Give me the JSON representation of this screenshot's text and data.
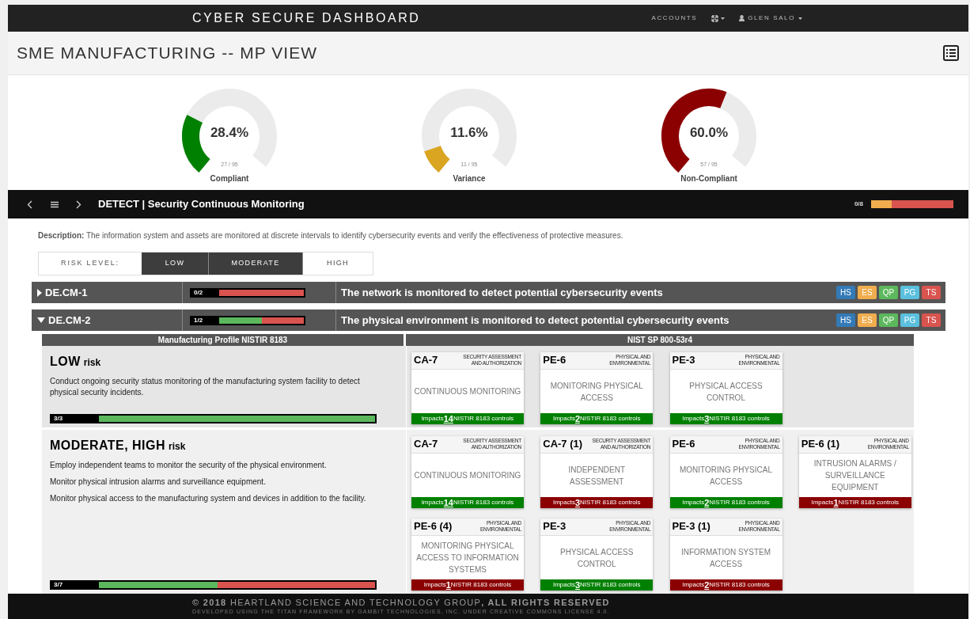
{
  "navbar": {
    "brand": "CYBER SECURE DASHBOARD",
    "links": [
      "ACCOUNTS"
    ],
    "user": "GLEN SALO"
  },
  "page_title": "SME MANUFACTURING -- MP VIEW",
  "gauges": [
    {
      "value": "28.4%",
      "count": "27 / 95",
      "label": "Compliant",
      "color": "#008000"
    },
    {
      "value": "11.6%",
      "count": "11 / 95",
      "label": "Variance",
      "color": "#daa520"
    },
    {
      "value": "60.0%",
      "count": "57 / 95",
      "label": "Non-Compliant",
      "color": "#8b0000"
    }
  ],
  "section": {
    "title": "DETECT | Security Continuous Monitoring",
    "progress_text": "0/8",
    "segments": [
      {
        "color": "#f0ad4e"
      },
      {
        "color": "#d9534f"
      }
    ]
  },
  "description": "**Description:** The information system and assets are monitored at discrete intervals to identify cybersecurity events and verify the effectiveness of protective measures.",
  "risk_level": {
    "label": "RISK LEVEL:",
    "options": [
      {
        "label": "LOW",
        "selected": true
      },
      {
        "label": "MODERATE",
        "selected": true
      },
      {
        "label": "HIGH",
        "selected": false
      }
    ]
  },
  "subcategories": [
    {
      "id": "DE.CM-1",
      "expanded": false,
      "progress_text": "0/2",
      "segments": [
        {
          "color": "#d9534f"
        }
      ],
      "text": "The network is monitored to detect potential cybersecurity events",
      "tags": [
        {
          "label": "HS",
          "color": "#337ab7"
        },
        {
          "label": "ES",
          "color": "#f0ad4e"
        },
        {
          "label": "QP",
          "color": "#5cb85c"
        },
        {
          "label": "PG",
          "color": "#5bc0de"
        },
        {
          "label": "TS",
          "color": "#d9534f"
        }
      ]
    },
    {
      "id": "DE.CM-2",
      "expanded": true,
      "progress_text": "1/2",
      "segments": [
        {
          "color": "#5cb85c"
        },
        {
          "color": "#d9534f"
        }
      ],
      "text": "The physical environment is monitored to detect potential cybersecurity events",
      "tags": [
        {
          "label": "HS",
          "color": "#337ab7"
        },
        {
          "label": "ES",
          "color": "#f0ad4e"
        },
        {
          "label": "QP",
          "color": "#5cb85c"
        },
        {
          "label": "PG",
          "color": "#5bc0de"
        },
        {
          "label": "TS",
          "color": "#d9534f"
        }
      ]
    }
  ],
  "detail": {
    "left_heading": "Manufacturing Profile NISTIR 8183",
    "right_heading": "NIST SP 800-53r4",
    "rows": [
      {
        "risk": "LOW",
        "suffix": "risk",
        "statements": [
          "Conduct ongoing security status monitoring of the manufacturing system facility to detect physical security incidents."
        ],
        "progress_text": "3/3",
        "segments": [
          {
            "color": "#5cb85c"
          }
        ],
        "controls": [
          {
            "id": "CA-7",
            "family": "SECURITY ASSESSMENT AND AUTHORIZATION",
            "title": "CONTINUOUS MONITORING",
            "impacts": [
              "Impacts",
              "14",
              "NISTIR 8183 controls"
            ],
            "met": true
          },
          {
            "id": "PE-6",
            "family": "PHYSICAL AND ENVIRONMENTAL",
            "title": "MONITORING PHYSICAL ACCESS",
            "impacts": [
              "Impacts",
              "2",
              "NISTIR 8183 controls"
            ],
            "met": true
          },
          {
            "id": "PE-3",
            "family": "PHYSICAL AND ENVIRONMENTAL",
            "title": "PHYSICAL ACCESS CONTROL",
            "impacts": [
              "Impacts",
              "3",
              "NISTIR 8183 controls"
            ],
            "met": true
          }
        ]
      },
      {
        "risk": "MODERATE, HIGH",
        "suffix": "risk",
        "statements": [
          "Employ independent teams to monitor the security of the physical environment.",
          "Monitor physical intrusion alarms and surveillance equipment.",
          "Monitor physical access to the manufacturing system and devices in addition to the facility."
        ],
        "progress_text": "3/7",
        "segments": [
          {
            "color": "#5cb85c"
          },
          {
            "color": "#d9534f"
          }
        ],
        "controls": [
          {
            "id": "CA-7",
            "family": "SECURITY ASSESSMENT AND AUTHORIZATION",
            "title": "CONTINUOUS MONITORING",
            "impacts": [
              "Impacts",
              "14",
              "NISTIR 8183 controls"
            ],
            "met": true
          },
          {
            "id": "CA-7 (1)",
            "family": "SECURITY ASSESSMENT AND AUTHORIZATION",
            "title": "INDEPENDENT ASSESSMENT",
            "impacts": [
              "Impacts",
              "3",
              "NISTIR 8183 controls"
            ],
            "met": false
          },
          {
            "id": "PE-6",
            "family": "PHYSICAL AND ENVIRONMENTAL",
            "title": "MONITORING PHYSICAL ACCESS",
            "impacts": [
              "Impacts",
              "2",
              "NISTIR 8183 controls"
            ],
            "met": true
          },
          {
            "id": "PE-6 (1)",
            "family": "PHYSICAL AND ENVIRONMENTAL",
            "title": "INTRUSION ALARMS / SURVEILLANCE EQUIPMENT",
            "impacts": [
              "Impacts",
              "1",
              "NISTIR 8183 controls"
            ],
            "met": false
          },
          {
            "id": "PE-6 (4)",
            "family": "PHYSICAL AND ENVIRONMENTAL",
            "title": "MONITORING PHYSICAL ACCESS TO INFORMATION SYSTEMS",
            "impacts": [
              "Impacts",
              "1",
              "NISTIR 8183 controls"
            ],
            "met": false
          },
          {
            "id": "PE-3",
            "family": "PHYSICAL AND ENVIRONMENTAL",
            "title": "PHYSICAL ACCESS CONTROL",
            "impacts": [
              "Impacts",
              "3",
              "NISTIR 8183 controls"
            ],
            "met": true
          },
          {
            "id": "PE-3 (1)",
            "family": "PHYSICAL AND ENVIRONMENTAL",
            "title": "INFORMATION SYSTEM ACCESS",
            "impacts": [
              "Impacts",
              "2",
              "NISTIR 8183 controls"
            ],
            "met": false
          }
        ]
      }
    ]
  },
  "footer": {
    "copyright": "**© 2018** HEARTLAND SCIENCE AND TECHNOLOGY GROUP**, ALL RIGHTS RESERVED**",
    "credit": "DEVELOPED USING THE TITAN FRAMEWORK BY GAMBIT TECHNOLOGIES, INC. UNDER CREATIVE COMMONS LICENSE 4.0."
  }
}
